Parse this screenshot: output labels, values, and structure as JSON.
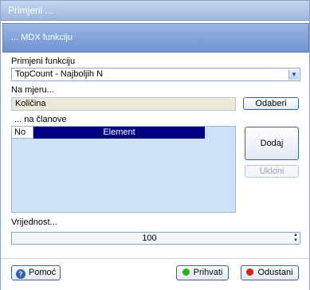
{
  "window": {
    "title": "Primjeni ..."
  },
  "header": {
    "title": "... MDX funkciju"
  },
  "function": {
    "label": "Primjeni funkciju",
    "selected": "TopCount - Najboljih N"
  },
  "measure": {
    "label": "Na mjeru...",
    "value": "Količina",
    "choose_label": "Odaberi"
  },
  "members": {
    "label": "... na članove",
    "columns": [
      "No",
      "Element"
    ],
    "add_label": "Dodaj",
    "remove_label": "Ukloni"
  },
  "value": {
    "label": "Vrijednost...",
    "number": "100"
  },
  "footer": {
    "help_label": "Pomoć",
    "accept_label": "Prihvati",
    "cancel_label": "Odustani"
  },
  "colors": {
    "accept_dot": "#27b31b",
    "cancel_dot": "#d81d1d",
    "header_selected": "#000080"
  },
  "icons": {
    "help": "question-icon",
    "accept": "green-dot-icon",
    "cancel": "red-dot-icon",
    "dropdown": "chevron-down-icon",
    "spinner": "spinner-arrows-icon"
  }
}
